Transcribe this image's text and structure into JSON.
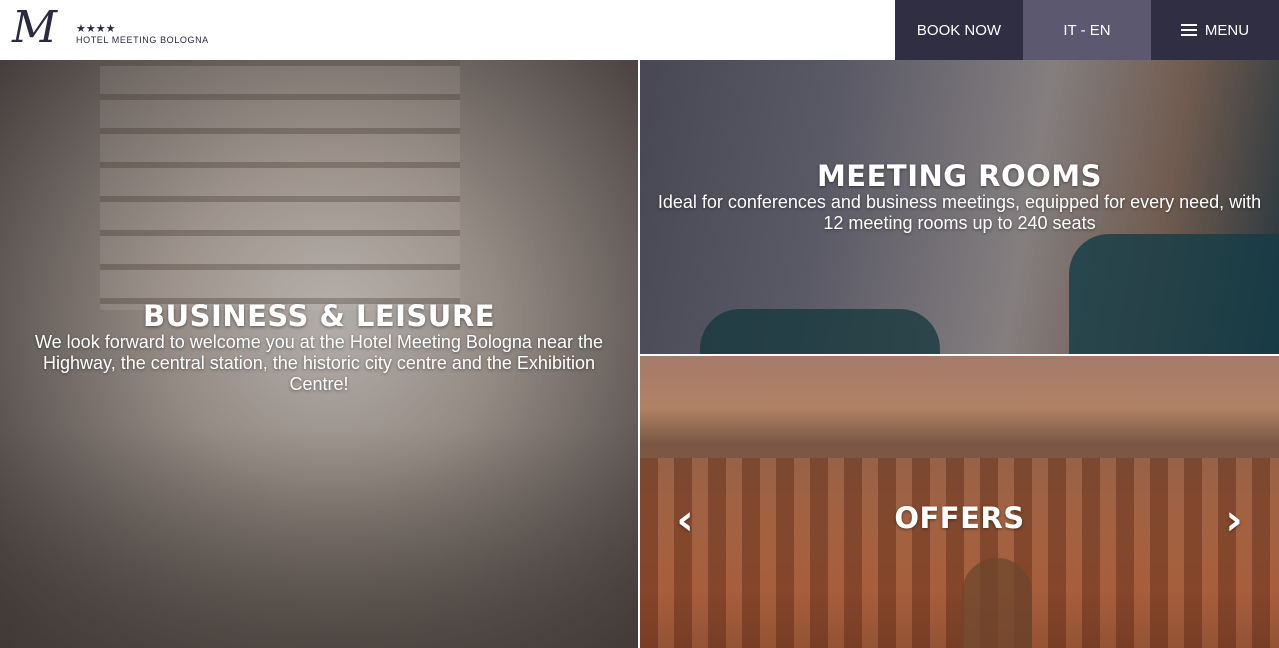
{
  "header": {
    "logo": {
      "letter": "M",
      "stars": "★★★★",
      "name": "HOTEL MEETING BOLOGNA"
    },
    "nav": {
      "book_label": "BOOK NOW",
      "lang_label": "IT - EN",
      "menu_label": "MENU"
    }
  },
  "panels": {
    "left": {
      "title": "BUSINESS & LEISURE",
      "text": "We look forward to welcome you at the Hotel Meeting Bologna near the Highway, the central station, the historic city centre and the Exhibition Centre!"
    },
    "top_right": {
      "title": "MEETING ROOMS",
      "text": "Ideal for conferences and business meetings, equipped for every need, with 12 meeting rooms up to 240 seats"
    },
    "bottom_right": {
      "title": "OFFERS",
      "prev_icon": "‹",
      "next_icon": "›"
    }
  },
  "colors": {
    "nav_dark": "#2f2e43",
    "nav_light": "#5b5870",
    "logo": "#2a2a40"
  }
}
